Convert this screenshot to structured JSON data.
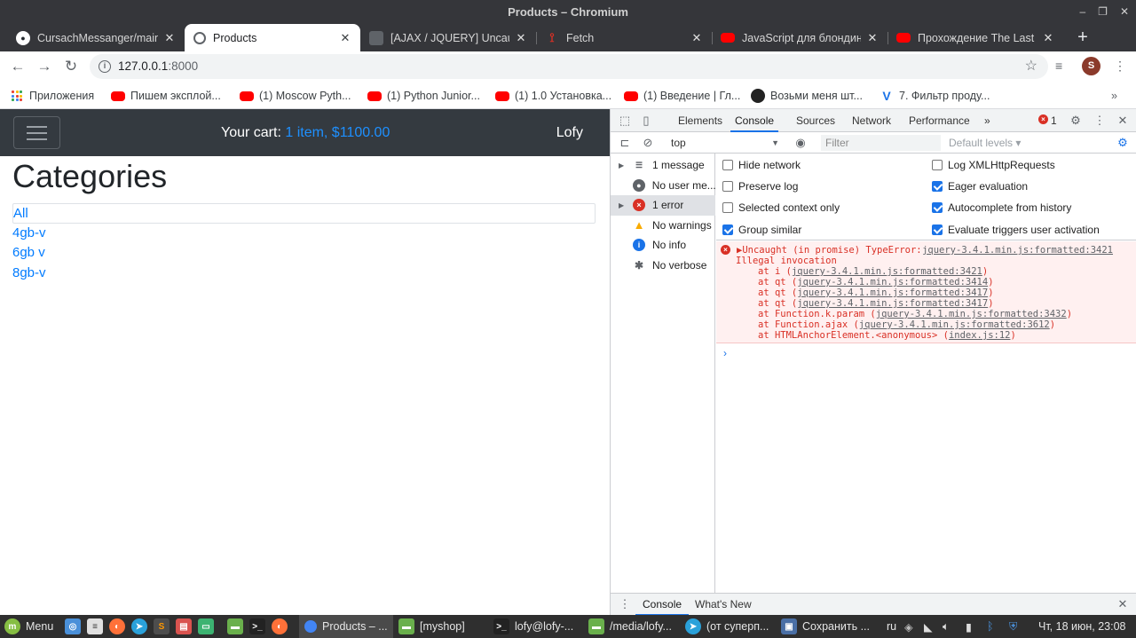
{
  "window": {
    "title": "Products – Chromium",
    "controls": [
      "‒",
      "❐",
      "✕"
    ]
  },
  "tabs": [
    {
      "title": "CursachMessanger/main.j",
      "icon": "github-icon",
      "active": false
    },
    {
      "title": "Products",
      "icon": "globe-icon",
      "active": true
    },
    {
      "title": "[AJAX / JQUERY] Uncaug",
      "icon": "page-icon",
      "active": false
    },
    {
      "title": "Fetch",
      "icon": "fetch-icon",
      "active": false
    },
    {
      "title": "JavaScript для блондин",
      "icon": "youtube-icon",
      "active": false
    },
    {
      "title": "Прохождение The Last o",
      "icon": "youtube-icon",
      "active": false
    }
  ],
  "toolbar": {
    "url_host": "127.0.0.1",
    "url_port": ":8000",
    "avatar_letter": "S"
  },
  "bookmarks": [
    {
      "label": "Приложения",
      "icon": "apps-grid-icon"
    },
    {
      "label": "Пишем эксплой...",
      "icon": "youtube-icon"
    },
    {
      "label": "(1) Moscow Pyth...",
      "icon": "youtube-icon"
    },
    {
      "label": "(1) Python Junior...",
      "icon": "youtube-icon"
    },
    {
      "label": "(1) 1.0 Установка...",
      "icon": "youtube-icon"
    },
    {
      "label": "(1) Введение | Гл...",
      "icon": "youtube-icon"
    },
    {
      "label": "Возьми меня шт...",
      "icon": "ninja-icon"
    },
    {
      "label": "7. Фильтр проду...",
      "icon": "v-logo-icon"
    }
  ],
  "page": {
    "cart_label": "Your cart:",
    "cart_value": "1 item, $1100.00",
    "user": "Lofy",
    "heading": "Categories",
    "categories": [
      "All",
      "4gb-v",
      "6gb v",
      "8gb-v"
    ]
  },
  "devtools": {
    "tabs": [
      "Elements",
      "Console",
      "Sources",
      "Network",
      "Performance"
    ],
    "active_tab": "Console",
    "more": "»",
    "error_count": "1",
    "context": "top",
    "filter_placeholder": "Filter",
    "levels": "Default levels ▾",
    "sidebar": [
      {
        "label": "1 message",
        "icon": "list-icon"
      },
      {
        "label": "No user me...",
        "icon": "user-icon"
      },
      {
        "label": "1 error",
        "icon": "error-icon"
      },
      {
        "label": "No warnings",
        "icon": "warning-icon"
      },
      {
        "label": "No info",
        "icon": "info-icon"
      },
      {
        "label": "No verbose",
        "icon": "bug-icon"
      }
    ],
    "settings": [
      {
        "label": "Hide network",
        "checked": false
      },
      {
        "label": "Log XMLHttpRequests",
        "checked": false
      },
      {
        "label": "Preserve log",
        "checked": false
      },
      {
        "label": "Eager evaluation",
        "checked": true
      },
      {
        "label": "Selected context only",
        "checked": false
      },
      {
        "label": "Autocomplete from history",
        "checked": true
      },
      {
        "label": "Group similar",
        "checked": true
      },
      {
        "label": "Evaluate triggers user activation",
        "checked": true
      }
    ],
    "error": {
      "headline": "▶Uncaught (in promise) TypeError:",
      "headline_link": "jquery-3.4.1.min.js:formatted:3421",
      "line2": "Illegal invocation",
      "frames": [
        {
          "text": "at i (",
          "link": "jquery-3.4.1.min.js:formatted:3421",
          "end": ")"
        },
        {
          "text": "at qt (",
          "link": "jquery-3.4.1.min.js:formatted:3414",
          "end": ")"
        },
        {
          "text": "at qt (",
          "link": "jquery-3.4.1.min.js:formatted:3417",
          "end": ")"
        },
        {
          "text": "at qt (",
          "link": "jquery-3.4.1.min.js:formatted:3417",
          "end": ")"
        },
        {
          "text": "at Function.k.param (",
          "link": "jquery-3.4.1.min.js:formatted:3432",
          "end": ")"
        },
        {
          "text": "at Function.ajax (",
          "link": "jquery-3.4.1.min.js:formatted:3612",
          "end": ")"
        },
        {
          "text": "at HTMLAnchorElement.<anonymous> (",
          "link": "index.js:12",
          "end": ")"
        }
      ]
    },
    "prompt": "›",
    "drawer_tabs": [
      "Console",
      "What's New"
    ]
  },
  "taskbar": {
    "menu": "Menu",
    "windows": [
      {
        "label": "Products – ...",
        "icon": "chromium-icon"
      },
      {
        "label": "[myshop]",
        "icon": "folder-icon"
      },
      {
        "label": "lofy@lofy-...",
        "icon": "terminal-icon"
      },
      {
        "label": "/media/lofy...",
        "icon": "folder-icon"
      },
      {
        "label": "(от суперп...",
        "icon": "telegram-icon"
      },
      {
        "label": "Сохранить ...",
        "icon": "save-icon"
      }
    ],
    "lang": "ru",
    "clock": "Чт, 18 июн, 23:08"
  },
  "colors": {
    "accent": "#1a73e8",
    "link": "#007bff",
    "navbar": "#343a40",
    "error": "#d93025"
  }
}
